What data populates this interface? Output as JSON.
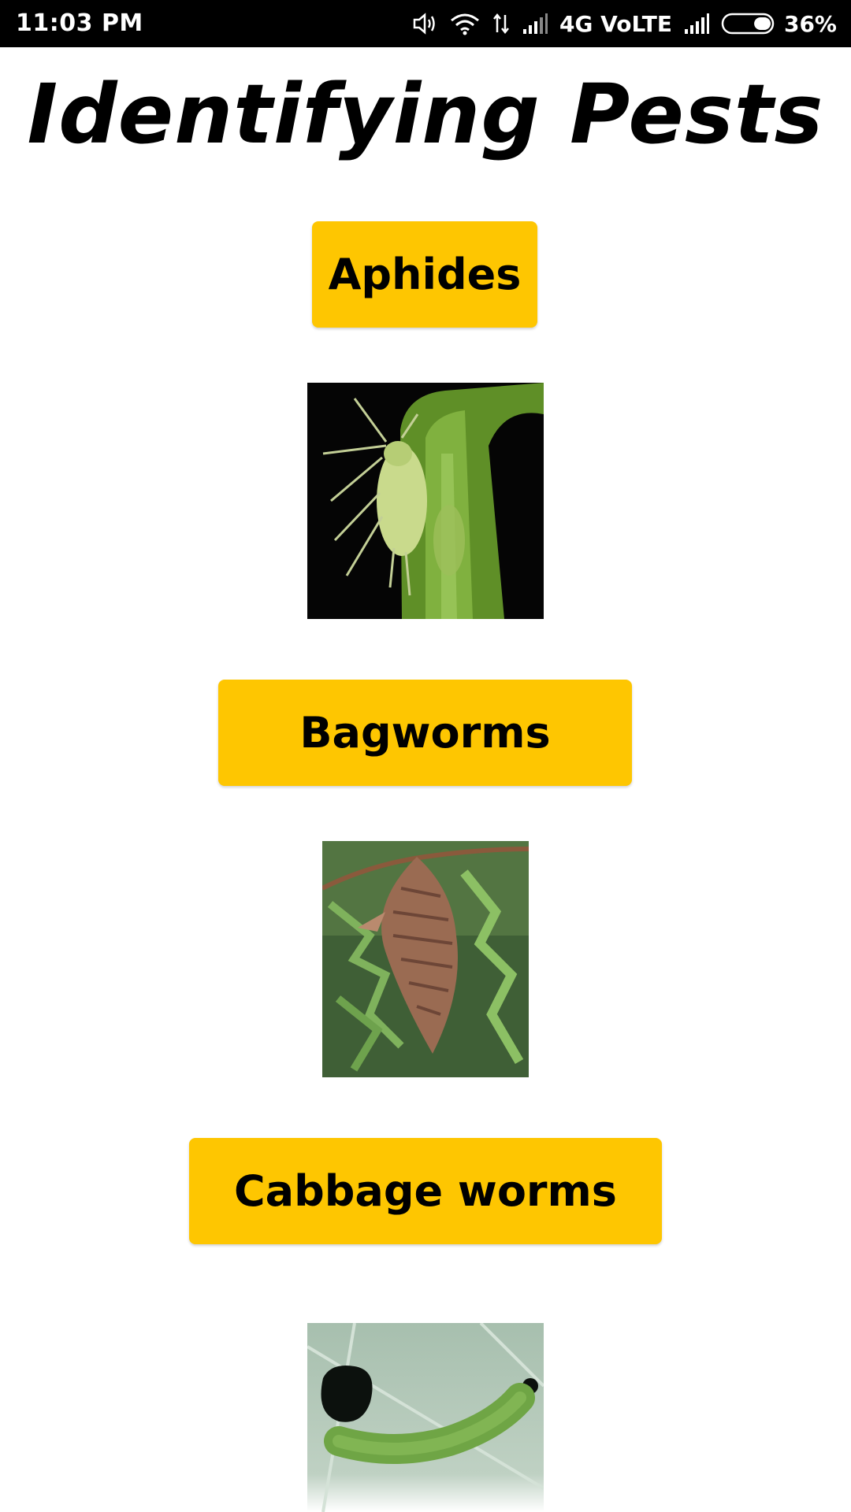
{
  "status_bar": {
    "time": "11:03 PM",
    "network_label": "4G VoLTE",
    "battery_percent": "36%",
    "battery_level": 0.36
  },
  "page": {
    "title": "Identifying Pests"
  },
  "pests": [
    {
      "label": "Aphides",
      "image": "aphid-photo"
    },
    {
      "label": "Bagworms",
      "image": "bagworm-photo"
    },
    {
      "label": "Cabbage worms",
      "image": "cabbage-worm-photo"
    }
  ],
  "colors": {
    "button_background": "#FEC601",
    "status_bar_background": "#000000",
    "page_background": "#FFFFFF"
  }
}
